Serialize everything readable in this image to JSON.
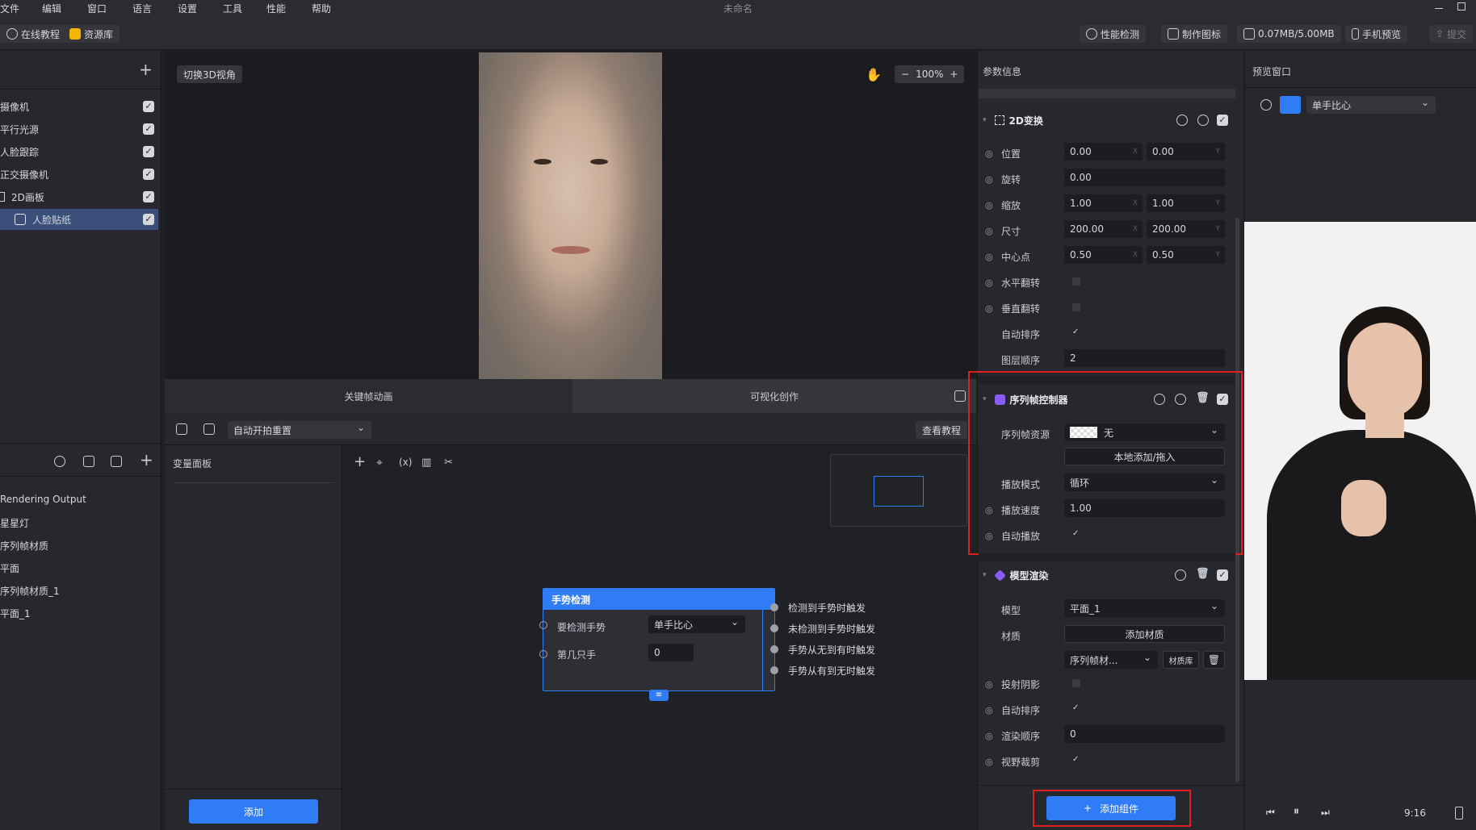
{
  "window": {
    "title": "未命名"
  },
  "menu": [
    "文件",
    "编辑",
    "窗口",
    "语言",
    "设置",
    "工具",
    "性能",
    "帮助"
  ],
  "toolbar": {
    "tutorial": "在线教程",
    "assets": "资源库",
    "perf_check": "性能检测",
    "make_icon": "制作图标",
    "size": "0.07MB/5.00MB",
    "phone_preview": "手机预览",
    "submit": "提交"
  },
  "hierarchy": [
    {
      "label": "摄像机",
      "checked": true
    },
    {
      "label": "平行光源",
      "checked": true
    },
    {
      "label": "人脸跟踪",
      "checked": true
    },
    {
      "label": "正交摄像机",
      "checked": true
    },
    {
      "label": "2D画板",
      "checked": true
    },
    {
      "label": "人脸贴纸",
      "checked": true,
      "selected": true
    }
  ],
  "assets": [
    "Rendering Output",
    "星星灯",
    "序列帧材质",
    "平面",
    "序列帧材质_1",
    "平面_1"
  ],
  "viewport": {
    "switch_3d": "切换3D视角",
    "zoom": "100%"
  },
  "tabs": {
    "keyframe": "关键帧动画",
    "visual": "可视化创作"
  },
  "bottom": {
    "auto_reset": "自动开拍重置",
    "view_tutorial": "查看教程",
    "var_panel": "变量面板",
    "add": "添加"
  },
  "node": {
    "title": "手势检测",
    "detect_label": "要检测手势",
    "detect_value": "单手比心",
    "hand_label": "第几只手",
    "hand_value": "0",
    "outputs": [
      "检测到手势时触发",
      "未检测到手势时触发",
      "手势从无到有时触发",
      "手势从有到无时触发"
    ]
  },
  "params": {
    "header": "参数信息",
    "transform": {
      "title": "2D变换",
      "position": {
        "label": "位置",
        "x": "0.00",
        "y": "0.00"
      },
      "rotation": {
        "label": "旋转",
        "value": "0.00"
      },
      "scale": {
        "label": "缩放",
        "x": "1.00",
        "y": "1.00"
      },
      "size": {
        "label": "尺寸",
        "x": "200.00",
        "y": "200.00"
      },
      "pivot": {
        "label": "中心点",
        "x": "0.50",
        "y": "0.50"
      },
      "hflip": {
        "label": "水平翻转"
      },
      "vflip": {
        "label": "垂直翻转"
      },
      "autosort": {
        "label": "自动排序"
      },
      "layer": {
        "label": "图层顺序",
        "value": "2"
      }
    },
    "seq": {
      "title": "序列帧控制器",
      "resource": {
        "label": "序列帧资源",
        "value": "无"
      },
      "local_add": "本地添加/拖入",
      "mode": {
        "label": "播放模式",
        "value": "循环"
      },
      "speed": {
        "label": "播放速度",
        "value": "1.00"
      },
      "autoplay": {
        "label": "自动播放"
      }
    },
    "model": {
      "title": "模型渲染",
      "model": {
        "label": "模型",
        "value": "平面_1"
      },
      "material": {
        "label": "材质",
        "add": "添加材质",
        "value": "序列帧材...",
        "lib": "材质库"
      },
      "shadow": {
        "label": "投射阴影"
      },
      "autosort": {
        "label": "自动排序"
      },
      "order": {
        "label": "渲染顺序",
        "value": "0"
      },
      "culling": {
        "label": "视野裁剪"
      }
    },
    "add_component": "添加组件"
  },
  "preview": {
    "title": "预览窗口",
    "gesture": "单手比心",
    "ratio": "9:16"
  },
  "axis": {
    "x": "X",
    "y": "Y"
  }
}
